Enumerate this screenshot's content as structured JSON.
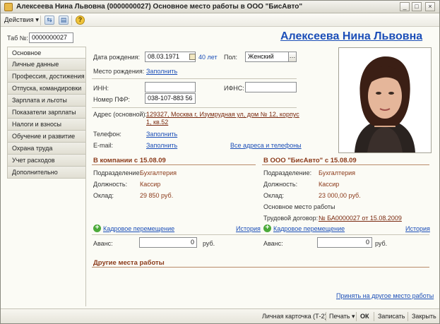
{
  "window": {
    "title": "Алексеева Нина Львовна (0000000027) Основное место работы в ООО \"БисАвто\"",
    "controls": [
      "_",
      "□",
      "×"
    ]
  },
  "toolbar": {
    "actions_label": "Действия ▾",
    "help_label": "?"
  },
  "header": {
    "tab_no_label": "Таб №:",
    "tab_no_value": "0000000027",
    "full_name": "Алексеева Нина Львовна"
  },
  "tabs": [
    "Основное",
    "Личные данные",
    "Профессия, достижения",
    "Отпуска, командировки",
    "Зарплата и льготы",
    "Показатели зарплаты",
    "Налоги и взносы",
    "Обучение и развитие",
    "Охрана труда",
    "Учет расходов",
    "Дополнительно"
  ],
  "personal": {
    "birth_date_label": "Дата рождения:",
    "birth_date_value": "08.03.1971",
    "age": "40 лет",
    "gender_label": "Пол:",
    "gender_value": "Женский",
    "birth_place_label": "Место рождения:",
    "birth_place_link": "Заполнить",
    "inn_label": "ИНН:",
    "inn_value": "",
    "ifns_label": "ИФНС:",
    "ifns_value": "",
    "pfr_label": "Номер ПФР:",
    "pfr_value": "038-107-883 56",
    "address_label": "Адрес (основной):",
    "address_line1": "129327, Москва г, Изумрудная ул, дом № 12, корпус",
    "address_line2": "1, кв.52",
    "phone_label": "Телефон:",
    "phone_link": "Заполнить",
    "email_label": "E-mail:",
    "email_link": "Заполнить",
    "all_contacts_link": "Все адреса и телефоны"
  },
  "company": {
    "title": "В компании с 15.08.09",
    "department_label": "Подразделение:",
    "department_value": "Бухгалтерия",
    "position_label": "Должность:",
    "position_value": "Кассир",
    "salary_label": "Оклад:",
    "salary_value": "29 850 руб.",
    "move_link": "Кадровое перемещение",
    "history_link": "История",
    "advance_label": "Аванс:",
    "advance_value": "0",
    "advance_unit": "руб."
  },
  "org": {
    "title": "В ООО \"БисАвто\" с 15.08.09",
    "department_label": "Подразделение:",
    "department_value": "Бухгалтерия",
    "position_label": "Должность:",
    "position_value": "Кассир",
    "salary_label": "Оклад:",
    "salary_value": "23 000,00 руб.",
    "work_type": "Основное место работы",
    "contract_label": "Трудовой договор:",
    "contract_link": "№ БА0000027 от 15.08.2009",
    "move_link": "Кадровое перемещение",
    "history_link": "История",
    "advance_label": "Аванс:",
    "advance_value": "0",
    "advance_unit": "руб."
  },
  "other_jobs": {
    "title": "Другие места работы",
    "accept_link": "Принять на другое место работы"
  },
  "bottom": {
    "personal_card": "Личная карточка (Т-2)",
    "print": "Печать ▾",
    "ok": "ОК",
    "save": "Записать",
    "close": "Закрыть"
  },
  "icons": [
    "app-icon",
    "actions-dropdown",
    "nav-back-icon",
    "nav-forward-icon",
    "help-icon",
    "calendar-icon",
    "select-dots-icon",
    "paperclip-icon",
    "add-green-icon"
  ]
}
